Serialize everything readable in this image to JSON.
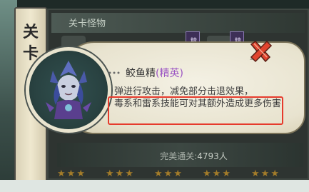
{
  "background": {
    "panel_title": "关卡",
    "section_label": "关卡怪物",
    "elite_tags": [
      "精英",
      "精英"
    ],
    "clear_label": "完美通关:",
    "clear_count": "4793人"
  },
  "popup": {
    "monster_name": "鲛鱼精",
    "monster_rank": "(精英)",
    "desc_line1": "弹进行攻击，减免部分击退效果，",
    "highlight_text": "毒系和雷系技能可对其额外造成更多伤害",
    "close_icon": "close-x-icon"
  },
  "colors": {
    "highlight_border": "#e63a2c",
    "rank_color": "#9a53c3",
    "close_red": "#e0442e"
  }
}
